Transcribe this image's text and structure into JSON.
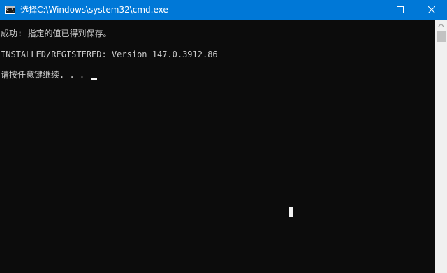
{
  "window": {
    "title": "选择C:\\Windows\\system32\\cmd.exe",
    "icon": "cmd-icon",
    "icon_prompt": "C:\\",
    "controls": [
      "minimize-icon",
      "maximize-icon",
      "close-icon"
    ],
    "titlebar_color": "#0078d7"
  },
  "console": {
    "background": "#0c0c0c",
    "text_color": "#cccccc",
    "lines": [
      "成功: 指定的值已得到保存。",
      "INSTALLED/REGISTERED: Version 147.0.3912.86",
      "请按任意键继续. . . "
    ]
  },
  "scrollbar": {
    "up_icon": "scroll-up-arrow-icon"
  }
}
